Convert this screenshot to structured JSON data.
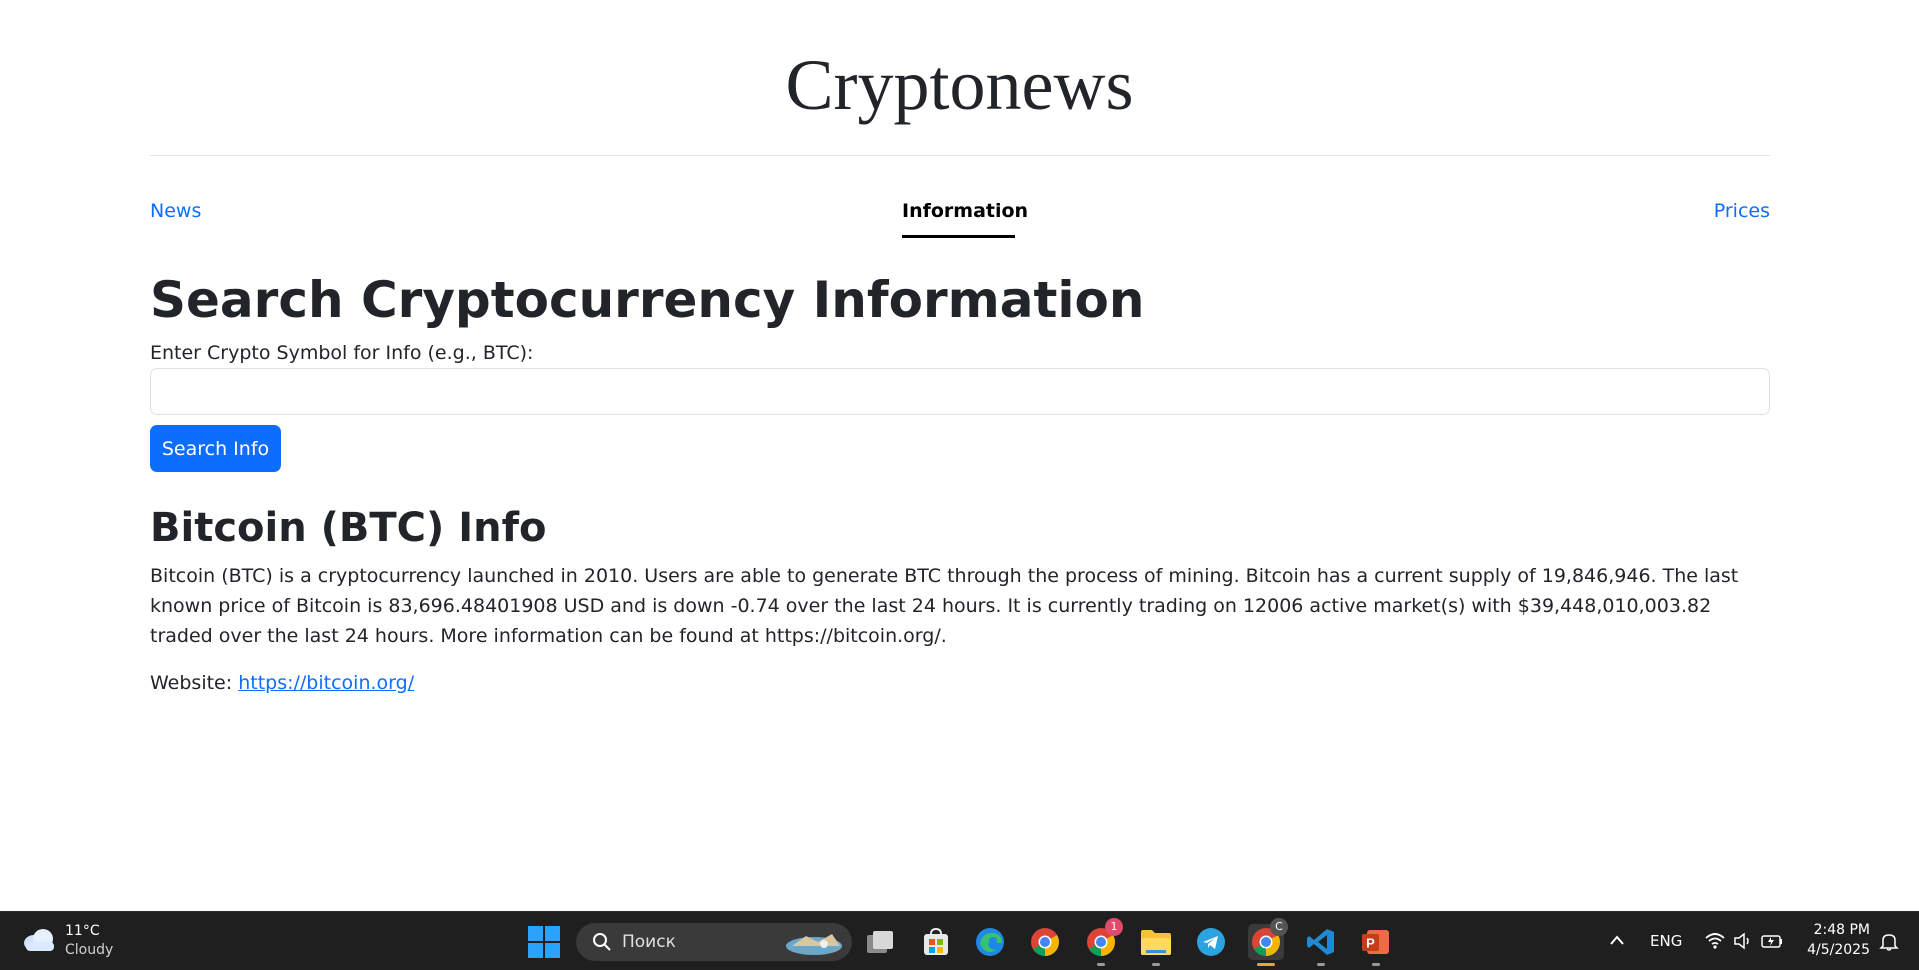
{
  "site": {
    "title": "Cryptonews"
  },
  "nav": {
    "news": "News",
    "information": "Information",
    "prices": "Prices"
  },
  "search": {
    "heading": "Search Cryptocurrency Information",
    "label": "Enter Crypto Symbol for Info (e.g., BTC):",
    "value": "",
    "placeholder": "",
    "button": "Search Info"
  },
  "result": {
    "heading": "Bitcoin (BTC) Info",
    "description": "Bitcoin (BTC) is a cryptocurrency launched in 2010. Users are able to generate BTC through the process of mining. Bitcoin has a current supply of 19,846,946. The last known price of Bitcoin is 83,696.48401908 USD and is down -0.74 over the last 24 hours. It is currently trading on 12006 active market(s) with $39,448,010,003.82 traded over the last 24 hours. More information can be found at https://bitcoin.org/.",
    "website_label": "Website:",
    "website_url": "https://bitcoin.org/"
  },
  "taskbar": {
    "weather": {
      "temp": "11°C",
      "condition": "Cloudy",
      "icon": "cloud-icon"
    },
    "search_text": "Поиск",
    "apps": [
      {
        "name": "task-view",
        "icon": "task-view-icon"
      },
      {
        "name": "store",
        "icon": "store-icon"
      },
      {
        "name": "edge",
        "icon": "edge-icon"
      },
      {
        "name": "chrome",
        "icon": "chrome-icon"
      },
      {
        "name": "chrome-profile",
        "icon": "chrome-icon",
        "badge": "1"
      },
      {
        "name": "file-explorer",
        "icon": "folder-icon"
      },
      {
        "name": "telegram",
        "icon": "telegram-icon"
      },
      {
        "name": "chrome-active",
        "icon": "chrome-icon",
        "badge": "C"
      },
      {
        "name": "vscode",
        "icon": "vscode-icon"
      },
      {
        "name": "powerpoint",
        "icon": "powerpoint-icon",
        "label": "P"
      }
    ],
    "language": "ENG",
    "time": "2:48 PM",
    "date": "4/5/2025"
  },
  "colors": {
    "link": "#0d6efd",
    "button": "#0d6efd",
    "taskbar": "#1f1f1f"
  }
}
